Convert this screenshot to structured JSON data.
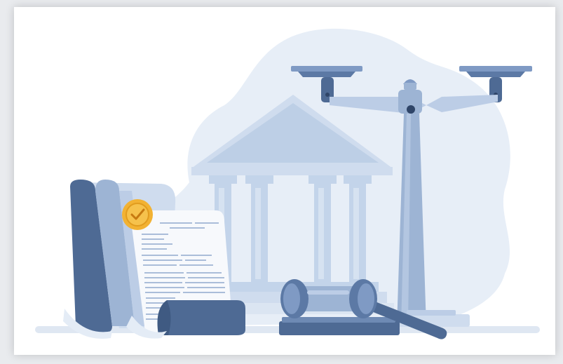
{
  "scene": {
    "subject": "justice-law-illustration",
    "colors": {
      "background": "#ffffff",
      "blob": "#e7eef7",
      "light_blue": "#cfdcee",
      "mid_blue": "#9db4d4",
      "steel_blue": "#7f9ac4",
      "dark_blue": "#4e6a94",
      "navy": "#3f5a82",
      "gold": "#f2b233",
      "ground": "#dfe7f2"
    },
    "icons": [
      "scroll-icon",
      "certificate-seal-icon",
      "courthouse-icon",
      "scales-of-justice-icon",
      "gavel-icon"
    ]
  }
}
